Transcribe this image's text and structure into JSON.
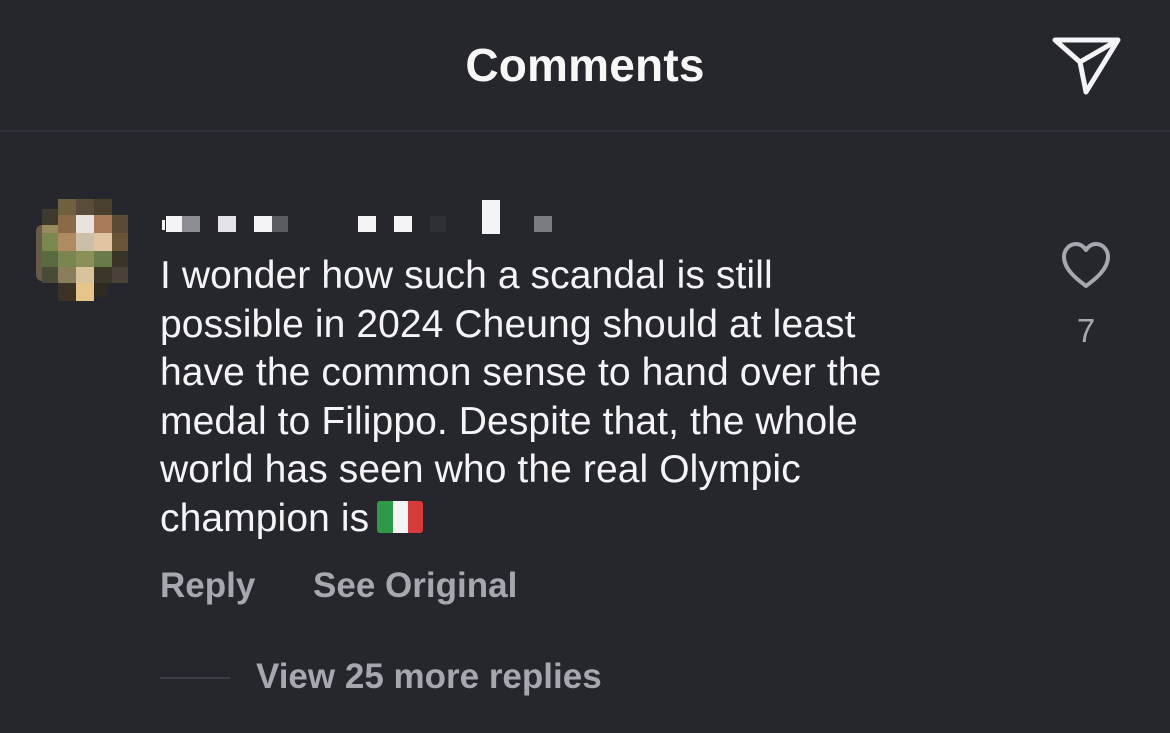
{
  "header": {
    "title": "Comments",
    "share_icon": "send-icon"
  },
  "comment": {
    "username": "",
    "text": "I wonder how such a scandal is still\npossible in 2024 Cheung should at least\nhave the common sense to hand over the\nmedal to Filippo. Despite that, the whole\nworld has seen who the real Olympic\nchampion is",
    "flag_icon": "italy-flag-icon",
    "like_count": "7",
    "like_icon": "heart-icon",
    "actions": {
      "reply_label": "Reply",
      "see_original_label": "See Original"
    },
    "view_replies_label": "View 25 more replies"
  },
  "colors": {
    "background": "#25272d",
    "text_primary": "#f4f4f6",
    "text_secondary": "#a6a8b0",
    "divider": "#2f323a",
    "flag_green": "#2e9a48",
    "flag_white": "#f4f4f4",
    "flag_red": "#d63a3a"
  }
}
